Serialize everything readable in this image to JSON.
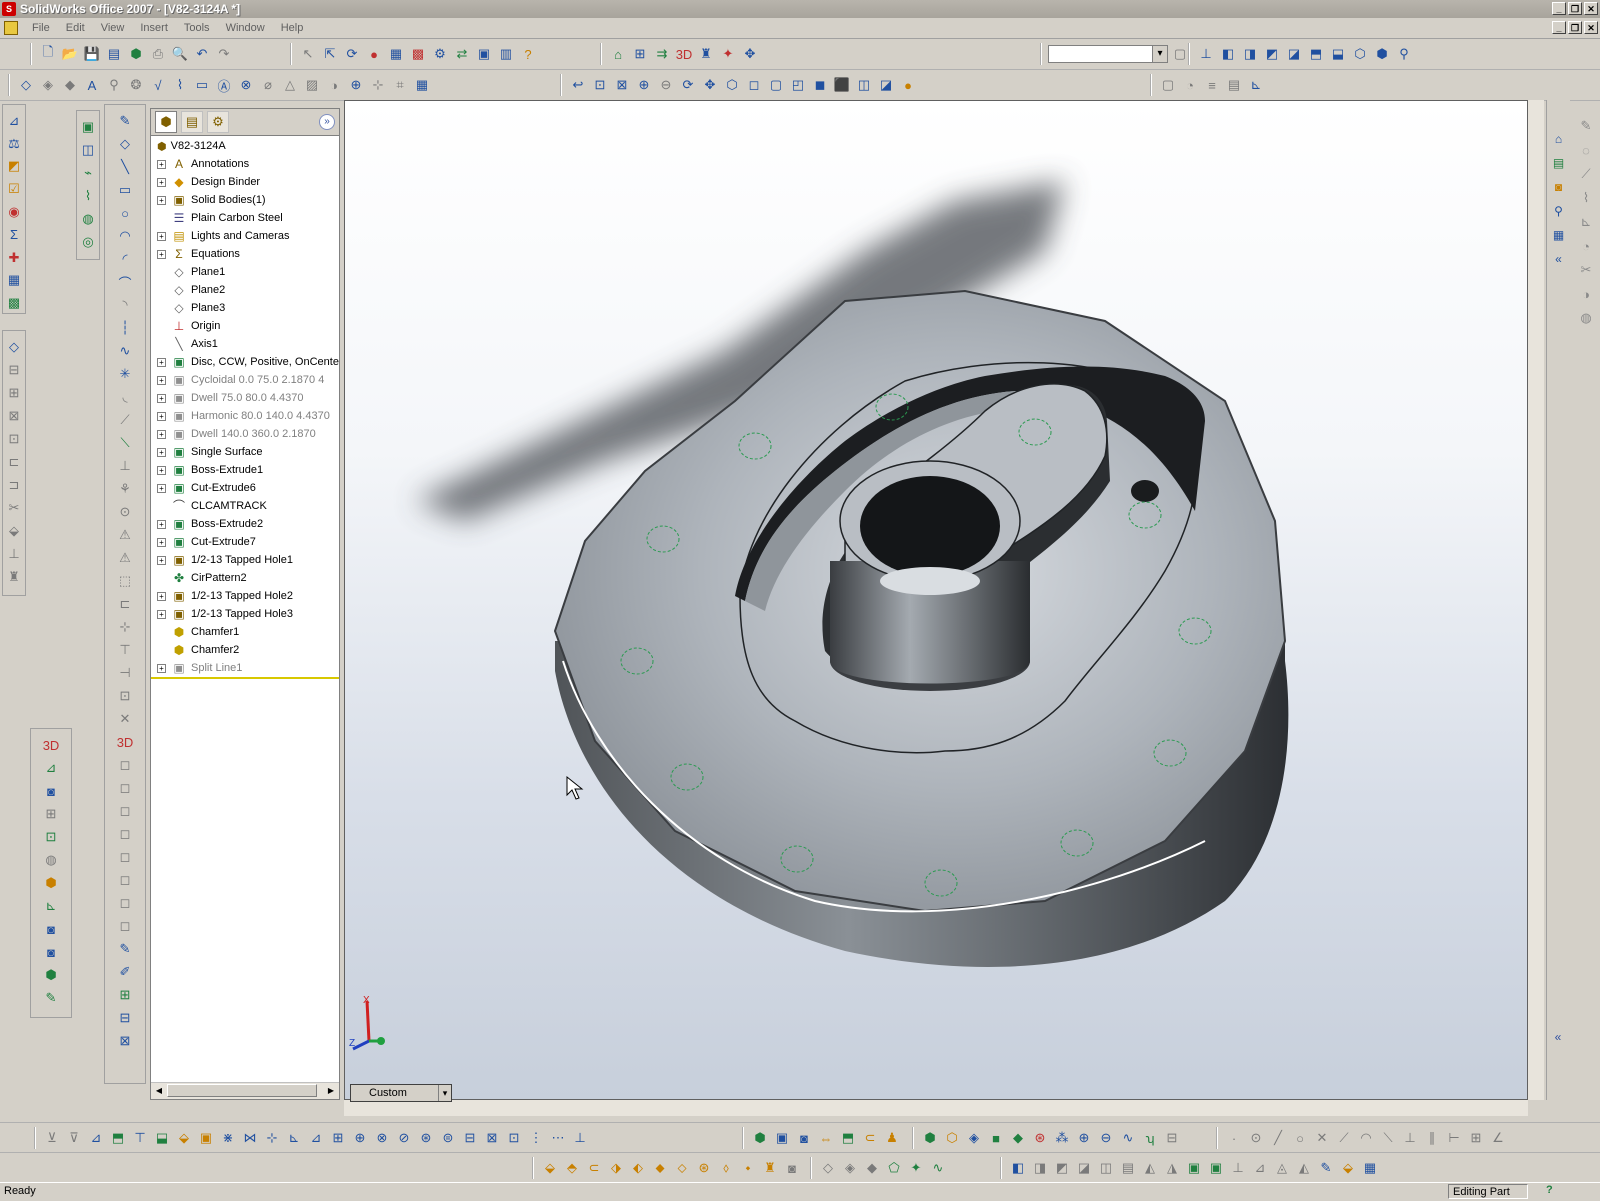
{
  "window": {
    "title": "SolidWorks Office 2007 - [V82-3124A *]",
    "app_icon_text": "S"
  },
  "menus": [
    "File",
    "Edit",
    "View",
    "Insert",
    "Tools",
    "Window",
    "Help"
  ],
  "feature_manager": {
    "root_label": "V82-3124A",
    "items": [
      {
        "label": "Annotations",
        "icon": "annotations-icon",
        "expandable": true,
        "dim": false
      },
      {
        "label": "Design Binder",
        "icon": "design-binder-icon",
        "expandable": true,
        "dim": false
      },
      {
        "label": "Solid Bodies(1)",
        "icon": "solid-bodies-icon",
        "expandable": true,
        "dim": false
      },
      {
        "label": "Plain Carbon Steel",
        "icon": "material-icon",
        "expandable": false,
        "dim": false
      },
      {
        "label": "Lights and Cameras",
        "icon": "lights-icon",
        "expandable": true,
        "dim": false
      },
      {
        "label": "Equations",
        "icon": "equations-icon",
        "expandable": true,
        "dim": false
      },
      {
        "label": "Plane1",
        "icon": "plane-icon",
        "expandable": false,
        "dim": false
      },
      {
        "label": "Plane2",
        "icon": "plane-icon",
        "expandable": false,
        "dim": false
      },
      {
        "label": "Plane3",
        "icon": "plane-icon",
        "expandable": false,
        "dim": false
      },
      {
        "label": "Origin",
        "icon": "origin-icon",
        "expandable": false,
        "dim": false
      },
      {
        "label": "Axis1",
        "icon": "axis-icon",
        "expandable": false,
        "dim": false
      },
      {
        "label": "Disc, CCW, Positive, OnCenter",
        "icon": "feature-icon",
        "expandable": true,
        "dim": false
      },
      {
        "label": "Cycloidal  0.0  75.0  2.1870  4",
        "icon": "feature-icon",
        "expandable": true,
        "dim": true
      },
      {
        "label": "Dwell  75.0  80.0  4.4370",
        "icon": "feature-icon",
        "expandable": true,
        "dim": true
      },
      {
        "label": "Harmonic  80.0  140.0  4.4370",
        "icon": "feature-icon",
        "expandable": true,
        "dim": true
      },
      {
        "label": "Dwell  140.0  360.0  2.1870",
        "icon": "feature-icon",
        "expandable": true,
        "dim": true
      },
      {
        "label": "Single Surface",
        "icon": "feature-icon",
        "expandable": true,
        "dim": false
      },
      {
        "label": "Boss-Extrude1",
        "icon": "extrude-icon",
        "expandable": true,
        "dim": false
      },
      {
        "label": "Cut-Extrude6",
        "icon": "extrude-icon",
        "expandable": true,
        "dim": false
      },
      {
        "label": "CLCAMTRACK",
        "icon": "sketch-curve-icon",
        "expandable": false,
        "dim": false
      },
      {
        "label": "Boss-Extrude2",
        "icon": "extrude-icon",
        "expandable": true,
        "dim": false
      },
      {
        "label": "Cut-Extrude7",
        "icon": "extrude-icon",
        "expandable": true,
        "dim": false
      },
      {
        "label": "1/2-13 Tapped Hole1",
        "icon": "hole-icon",
        "expandable": true,
        "dim": false
      },
      {
        "label": "CirPattern2",
        "icon": "pattern-icon",
        "expandable": false,
        "dim": false
      },
      {
        "label": "1/2-13 Tapped Hole2",
        "icon": "hole-icon",
        "expandable": true,
        "dim": false
      },
      {
        "label": "1/2-13 Tapped Hole3",
        "icon": "hole-icon",
        "expandable": true,
        "dim": false
      },
      {
        "label": "Chamfer1",
        "icon": "chamfer-icon",
        "expandable": false,
        "dim": false
      },
      {
        "label": "Chamfer2",
        "icon": "chamfer-icon",
        "expandable": false,
        "dim": false
      },
      {
        "label": "Split Line1",
        "icon": "split-line-icon",
        "expandable": true,
        "dim": true
      }
    ]
  },
  "viewport": {
    "view_orientation": "Custom",
    "triad": {
      "x": "X",
      "z": "Z"
    }
  },
  "status": {
    "left": "Ready",
    "mode": "Editing Part",
    "help": "?"
  },
  "colors": {
    "window_chrome": "#d4d0c8",
    "model_steel": "#9ca3ab",
    "hole_outline": "#2a9a50"
  }
}
